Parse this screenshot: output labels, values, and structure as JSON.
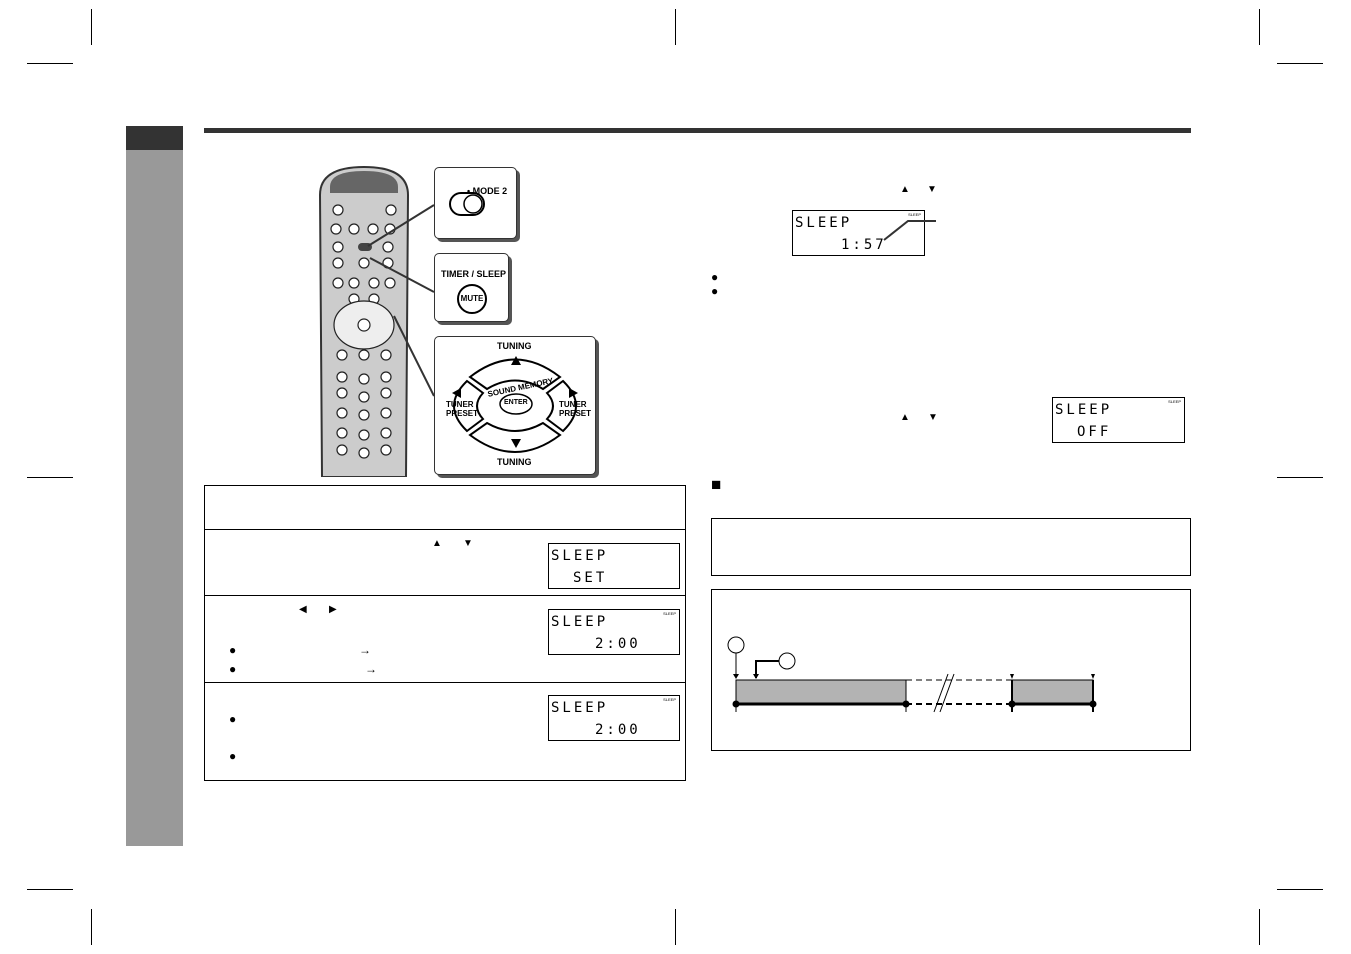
{
  "page": {
    "sections": {
      "timer_sleep_label": "TIMER / SLEEP"
    }
  },
  "remote": {
    "callouts": {
      "mode2_label": "• MODE 2",
      "timer_sleep_label": "TIMER / SLEEP",
      "mute_label": "MUTE",
      "tuning_up_label": "TUNING",
      "tuning_down_label": "TUNING",
      "sound_memory_label": "SOUND MEMORY",
      "enter_label": "ENTER",
      "tuner_preset_left": "TUNER PRESET",
      "tuner_preset_right": "TUNER PRESET",
      "icons": [
        "up-triangle-icon",
        "down-triangle-icon",
        "left-triangle-icon",
        "right-triangle-icon"
      ]
    }
  },
  "steps": {
    "step2": {
      "up": "▲",
      "down": "▼",
      "display_line1": "SLEEP",
      "display_line2": "SET"
    },
    "step3": {
      "left": "◀",
      "right": "▶",
      "display_line1": "SLEEP",
      "display_line2": "2:00",
      "indicator": "SLEEP",
      "arrow1": "→",
      "arrow2": "→",
      "bullet": "●"
    },
    "step4": {
      "display_line1": "SLEEP",
      "display_line2": "2:00",
      "indicator": "SLEEP",
      "bullet": "●"
    }
  },
  "right": {
    "check": {
      "up": "▲",
      "down": "▼",
      "display_line1": "SLEEP",
      "display_line2": "1:57",
      "indicator": "SLEEP",
      "bullet": "●"
    },
    "cancel": {
      "up": "▲",
      "down": "▼",
      "display_line1": "SLEEP",
      "display_line2": "OFF",
      "indicator": "SLEEP"
    },
    "section_marker": "■"
  },
  "diagram": {
    "segments": [
      "on-solid",
      "gap-dashed",
      "on-solid"
    ]
  }
}
